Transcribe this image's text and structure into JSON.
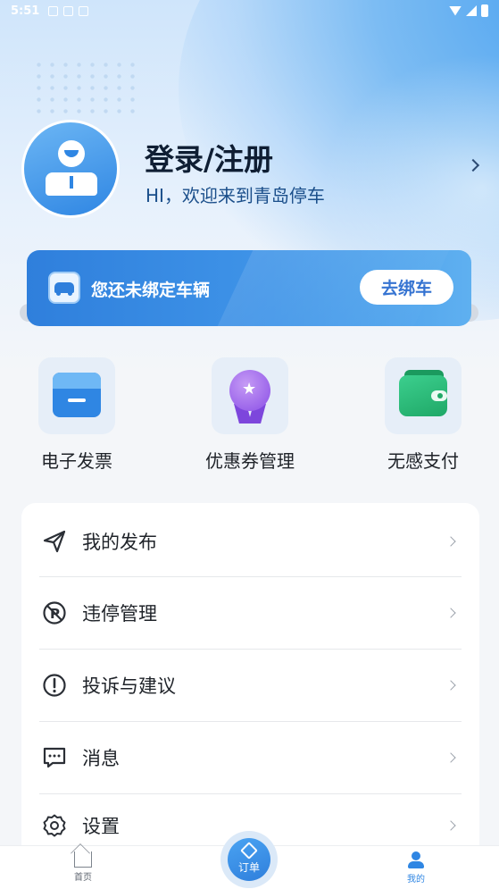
{
  "status_bar": {
    "time": "5:51"
  },
  "profile": {
    "title": "登录/注册",
    "subtitle": "HI，欢迎来到青岛停车"
  },
  "vehicle_banner": {
    "text": "您还未绑定车辆",
    "button": "去绑车"
  },
  "quick_actions": [
    {
      "label": "电子发票",
      "icon": "invoice-icon"
    },
    {
      "label": "优惠券管理",
      "icon": "coupon-medal-icon"
    },
    {
      "label": "无感支付",
      "icon": "wallet-icon"
    }
  ],
  "menu": [
    {
      "label": "我的发布",
      "icon": "send-icon"
    },
    {
      "label": "违停管理",
      "icon": "no-parking-icon"
    },
    {
      "label": "投诉与建议",
      "icon": "exclamation-icon"
    },
    {
      "label": "消息",
      "icon": "message-icon"
    },
    {
      "label": "设置",
      "icon": "gear-icon"
    }
  ],
  "tabbar": {
    "home": "首页",
    "orders": "订单",
    "me": "我的",
    "active": "me"
  },
  "colors": {
    "primary": "#2f7fdc",
    "accent_green": "#1fa867",
    "accent_purple": "#8a4fe6"
  }
}
